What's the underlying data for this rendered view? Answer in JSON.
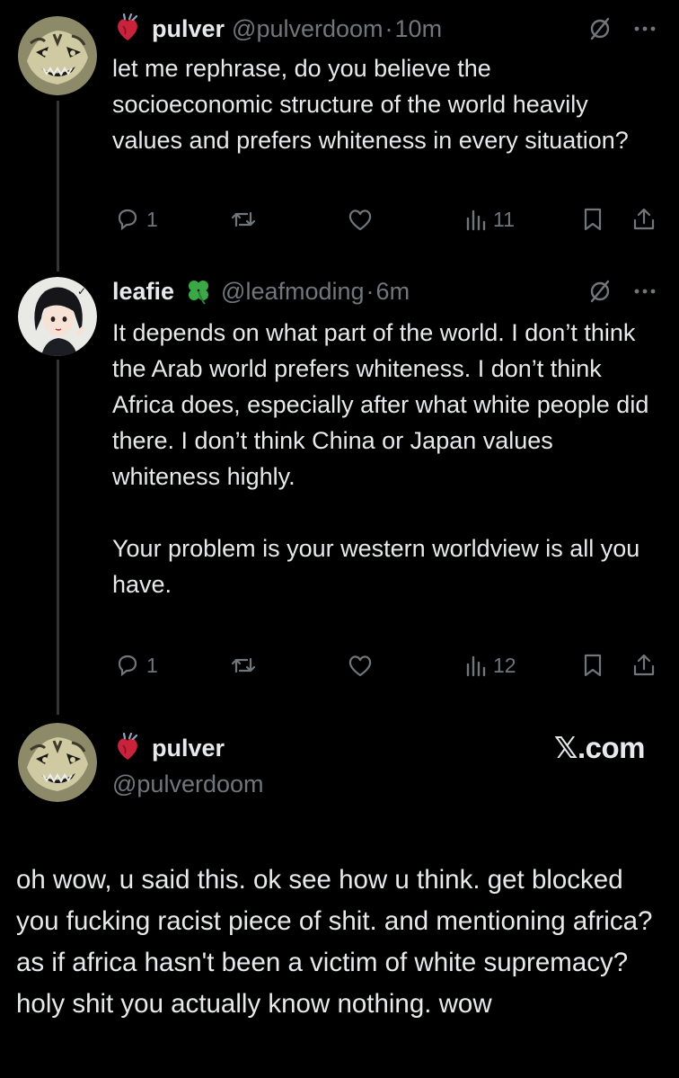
{
  "tweets": [
    {
      "name": "pulver",
      "handle": "@pulverdoom",
      "separator": "·",
      "time": "10m",
      "name_emoji": "anatomical-heart-emoji",
      "text": "let me rephrase, do you believe the socioeconomic structure of the world heavily values and prefers whiteness in every situation?",
      "replies": "1",
      "reposts": "",
      "likes": "",
      "views": "11"
    },
    {
      "name": "leafie",
      "handle": "@leafmoding",
      "separator": "·",
      "time": "6m",
      "name_emoji": "four-leaf-clover-emoji",
      "text": "It depends on what part of the world. I don’t think the Arab world prefers whiteness. I don’t think Africa does, especially after what white people did there. I don’t think China or Japan values whiteness highly.\n\nYour problem is your western worldview is all you have.",
      "replies": "1",
      "reposts": "",
      "likes": "",
      "views": "12"
    }
  ],
  "quote_card": {
    "name": "pulver",
    "handle": "@pulverdoom",
    "name_emoji": "anatomical-heart-emoji",
    "site": "𝕏.com",
    "text": "oh wow, u said this. ok see how u think. get blocked you fucking racist piece of shit. and mentioning africa? as if africa hasn't been a victim of white supremacy? holy shit you actually know nothing. wow"
  },
  "colors": {
    "background": "#000000",
    "text": "#e7e9ea",
    "muted": "#71767b",
    "thread_line": "#333639",
    "clover": "#3aa845",
    "heart": "#c8233a"
  }
}
